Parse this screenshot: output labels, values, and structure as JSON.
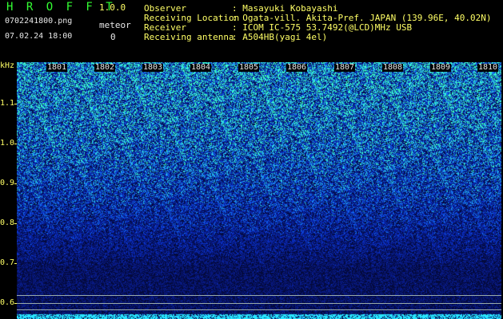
{
  "header": {
    "app_name": "H R O F F T",
    "version": "1.0.0",
    "filename": "0702241800.png",
    "datetime": "07.02.24 18:00",
    "meteor_label": "meteor",
    "meteor_count": "0",
    "info": [
      {
        "label": "Observer",
        "value": ": Masayuki Kobayashi"
      },
      {
        "label": "Receiving Location",
        "value": ": Ogata-vill. Akita-Pref. JAPAN (139.96E, 40.02N)"
      },
      {
        "label": "Receiver",
        "value": ": ICOM IC-575 53.7492(@LCD)MHz USB"
      },
      {
        "label": "Receiving antenna",
        "value": ": A504HB(yagi 4el)"
      }
    ]
  },
  "axis": {
    "unit": "kHz",
    "y_labels": [
      "1.1",
      "1.0",
      "0.9",
      "0.8",
      "0.7",
      "0.6"
    ],
    "time_labels": [
      "1801",
      "1802",
      "1803",
      "1804",
      "1805",
      "1806",
      "1807",
      "1808",
      "1809",
      "1810"
    ]
  },
  "colors": {
    "background": "#000000",
    "title_green": "#33ff33",
    "label_yellow": "#ffff66",
    "noise_low": "#0a1a6a",
    "noise_high": "#33ffcc"
  }
}
